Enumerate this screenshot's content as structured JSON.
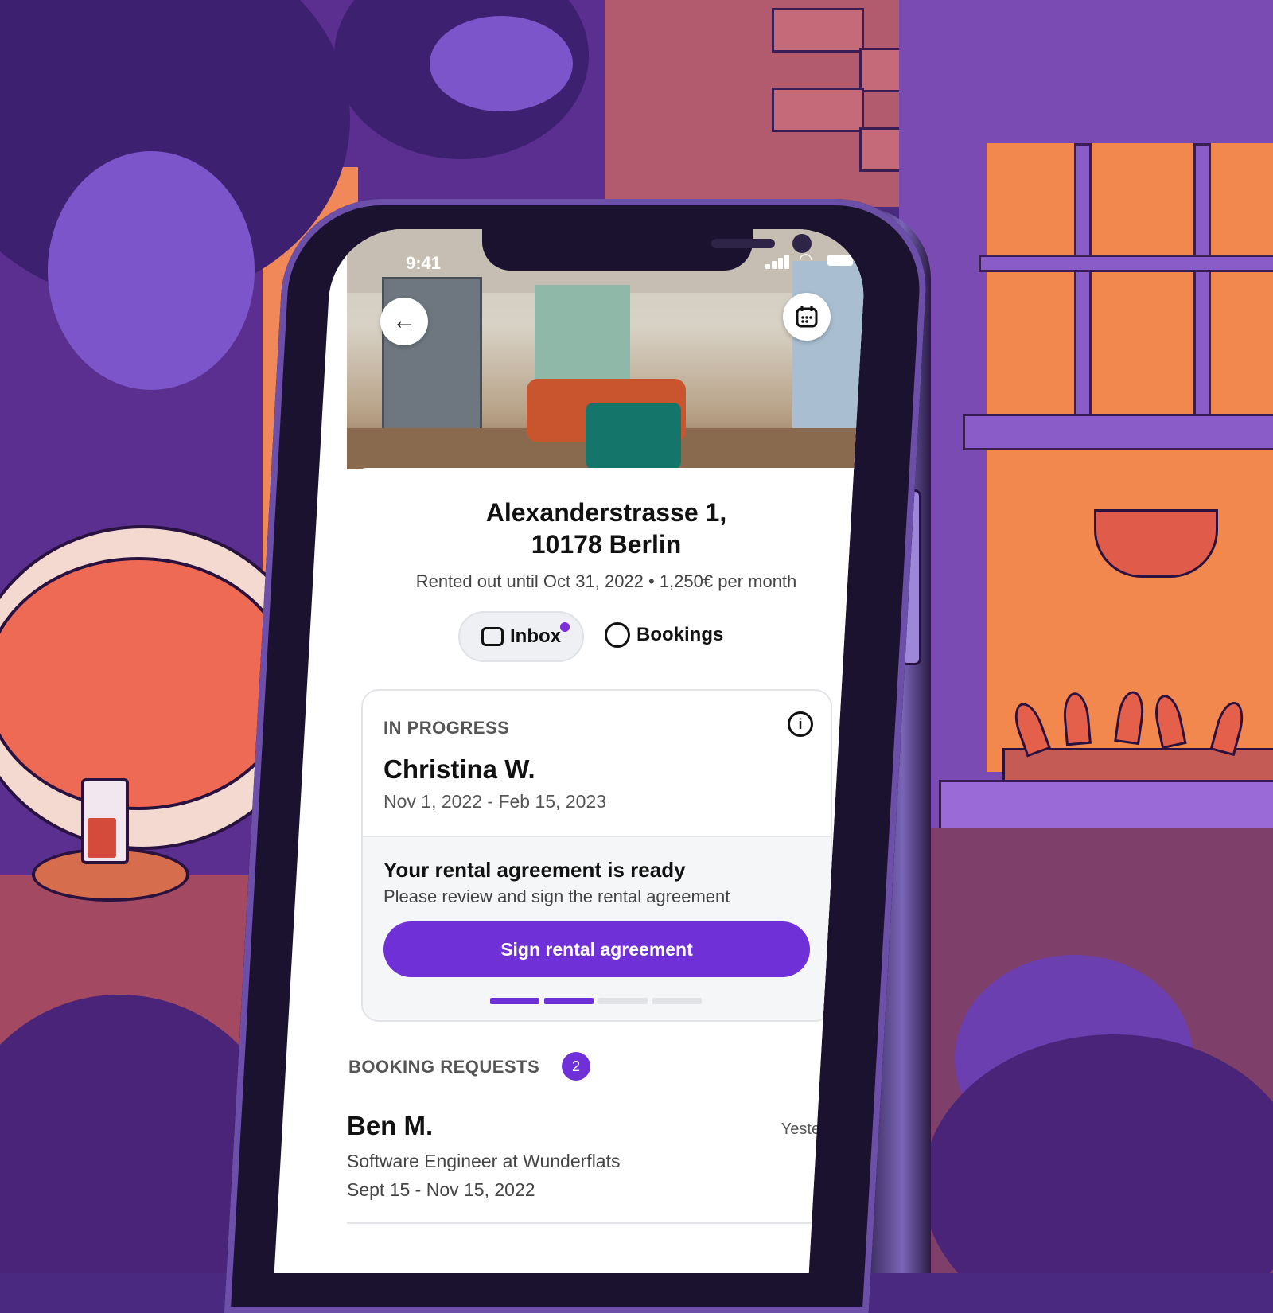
{
  "status_bar": {
    "time": "9:41"
  },
  "listing": {
    "address_line1": "Alexanderstrasse 1,",
    "address_line2": "10178 Berlin",
    "subline": "Rented out until Oct 31, 2022 • 1,250€ per month"
  },
  "nav": {
    "back_icon": "arrow-left-icon",
    "calendar_icon": "calendar-icon"
  },
  "tabs": [
    {
      "label": "Inbox",
      "icon": "inbox-icon",
      "active": true,
      "has_unread_dot": true
    },
    {
      "label": "Bookings",
      "icon": "user-circle-icon",
      "active": false
    }
  ],
  "in_progress": {
    "label": "IN PROGRESS",
    "name": "Christina W.",
    "dates": "Nov 1, 2022 - Feb 15, 2023",
    "message_title": "Your rental agreement is ready",
    "message_body": "Please review and sign the rental agreement",
    "button_label": "Sign rental agreement",
    "steps_total": 4,
    "steps_completed": 2
  },
  "booking_requests": {
    "label": "BOOKING REQUESTS",
    "count": "2",
    "items": [
      {
        "name": "Ben M.",
        "when": "Yesterday",
        "job": "Software Engineer at Wunderflats",
        "dates": "Sept 15 - Nov 15, 2022"
      }
    ]
  },
  "colors": {
    "accent": "#7030d8",
    "background": "#5a2f8f"
  }
}
